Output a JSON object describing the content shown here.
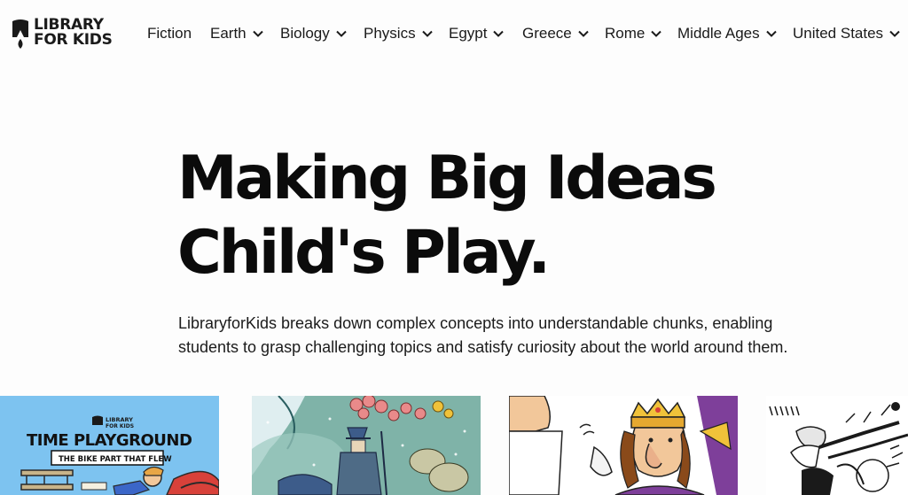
{
  "brand": {
    "line1": "LIBRARY",
    "line2": "FOR KIDS"
  },
  "nav": [
    {
      "label": "Fiction",
      "dropdown": false
    },
    {
      "label": "Earth",
      "dropdown": true
    },
    {
      "label": "Biology",
      "dropdown": true
    },
    {
      "label": "Physics",
      "dropdown": true
    },
    {
      "label": "Egypt",
      "dropdown": true
    },
    {
      "label": "Greece",
      "dropdown": true
    },
    {
      "label": "Rome",
      "dropdown": true
    },
    {
      "label": "Middle Ages",
      "dropdown": true
    },
    {
      "label": "United States",
      "dropdown": true
    }
  ],
  "hero": {
    "title_line1": "Making Big Ideas",
    "title_line2": "Child's Play.",
    "description": "LibraryforKids breaks down complex concepts into understandable chunks, enabling students to grasp challenging topics and satisfy curiosity about the world around them."
  },
  "cards": [
    {
      "brand_line1": "LIBRARY",
      "brand_line2": "FOR KIDS",
      "title": "TIME PLAYGROUND",
      "subtitle": "THE BIKE PART THAT FLEW"
    }
  ],
  "colors": {
    "text": "#111111",
    "background": "#fdfdfd",
    "card1_sky": "#7dc3f0"
  }
}
